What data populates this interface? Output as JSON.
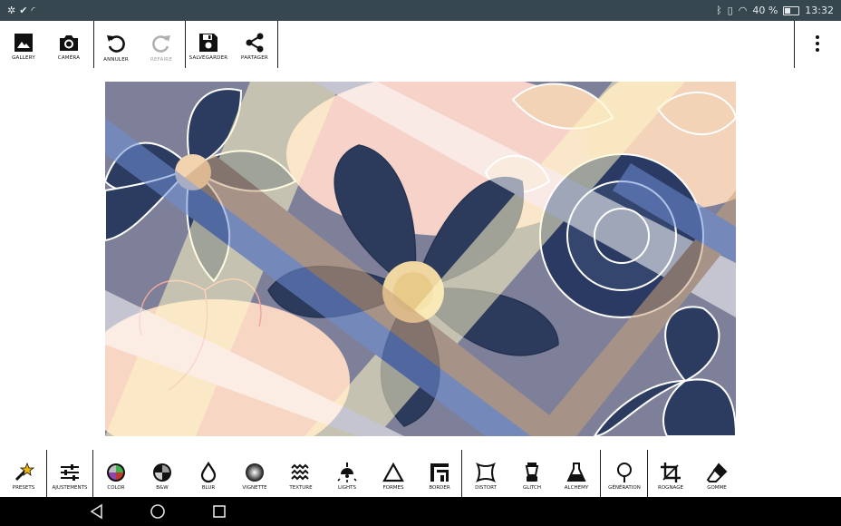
{
  "status_bar": {
    "battery": "40 %",
    "time": "13:32",
    "left_icons": [
      "settings-icon",
      "check-icon",
      "signal-icon"
    ],
    "right_icons": [
      "bluetooth-icon",
      "vibrate-icon",
      "wifi-icon",
      "battery-icon"
    ]
  },
  "toolbar": {
    "gallery": "GALLERY",
    "camera": "CAMÉRA",
    "undo": "ANNULER",
    "redo": "REFAIRE",
    "save": "SALVEGARDER",
    "share": "PARTAGER",
    "more_icon": "more-vert-icon"
  },
  "tools": [
    {
      "label": "PRESETS",
      "icon": "magic-wand-icon"
    },
    {
      "label": "AJUSTEMENTS",
      "icon": "sliders-icon"
    },
    {
      "label": "COLOR",
      "icon": "color-wheel-icon"
    },
    {
      "label": "B&W",
      "icon": "bw-icon"
    },
    {
      "label": "BLUR",
      "icon": "drop-icon"
    },
    {
      "label": "VIGNETTE",
      "icon": "vignette-icon"
    },
    {
      "label": "TEXTURE",
      "icon": "waves-icon"
    },
    {
      "label": "LIGHTS",
      "icon": "lamp-icon"
    },
    {
      "label": "FORMES",
      "icon": "triangle-icon"
    },
    {
      "label": "BORDER",
      "icon": "border-icon"
    },
    {
      "label": "DISTORT",
      "icon": "distort-icon"
    },
    {
      "label": "GLITCH",
      "icon": "blender-icon"
    },
    {
      "label": "ALCHEMY",
      "icon": "flask-icon"
    },
    {
      "label": "GÉNÉRATION",
      "icon": "tree-icon"
    },
    {
      "label": "ROGNAGE",
      "icon": "crop-icon"
    },
    {
      "label": "GOMME",
      "icon": "eraser-icon"
    }
  ],
  "colors": {
    "status_bar": "#37474f",
    "navy": "#2b3a5e",
    "peach": "#f2d3b5",
    "cream": "#fff5c8",
    "blue": "#6f8fd6"
  },
  "nav_icons": [
    "back-icon",
    "home-icon",
    "recents-icon"
  ]
}
